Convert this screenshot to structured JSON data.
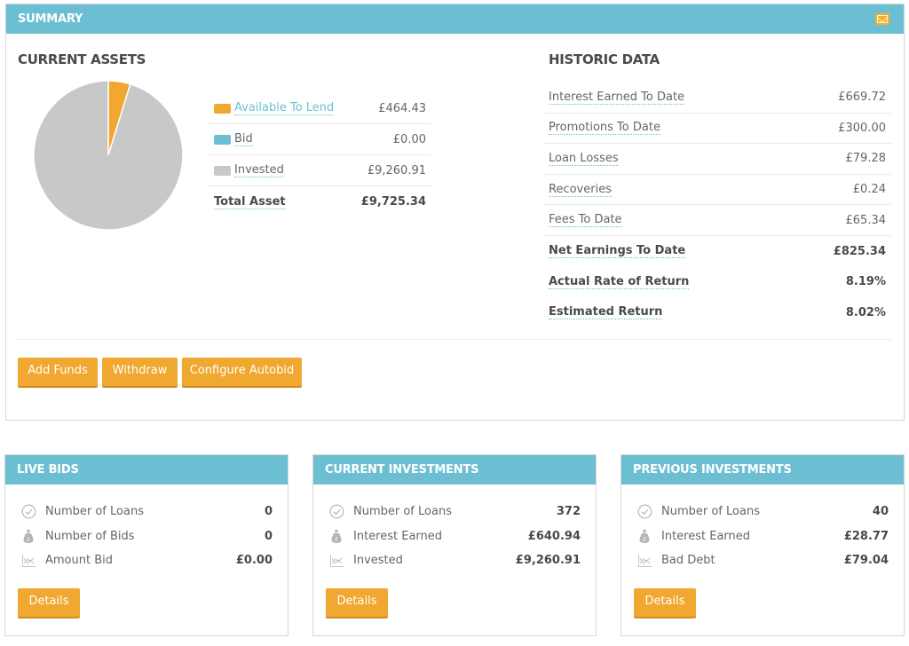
{
  "summary": {
    "title": "SUMMARY",
    "header_icon": "envelope-icon",
    "current_assets": {
      "title": "CURRENT ASSETS",
      "legend": [
        {
          "label": "Available To Lend",
          "value": "£464.43",
          "color": "#f0a830",
          "link": true
        },
        {
          "label": "Bid",
          "value": "£0.00",
          "color": "#6cbfd2",
          "link": false
        },
        {
          "label": "Invested",
          "value": "£9,260.91",
          "color": "#c8c8c8",
          "link": false
        }
      ],
      "total": {
        "label": "Total Asset",
        "value": "£9,725.34"
      }
    },
    "historic_data": {
      "title": "HISTORIC DATA",
      "rows": [
        {
          "label": "Interest Earned To Date",
          "value": "£669.72"
        },
        {
          "label": "Promotions To Date",
          "value": "£300.00"
        },
        {
          "label": "Loan Losses",
          "value": "£79.28"
        },
        {
          "label": "Recoveries",
          "value": "£0.24"
        },
        {
          "label": "Fees To Date",
          "value": "£65.34"
        }
      ],
      "bold_rows": [
        {
          "label": "Net Earnings To Date",
          "value": "£825.34"
        },
        {
          "label": "Actual Rate of Return",
          "value": "8.19%"
        },
        {
          "label": "Estimated Return",
          "value": "8.02%"
        }
      ]
    },
    "buttons": {
      "add_funds": "Add Funds",
      "withdraw": "Withdraw",
      "configure_autobid": "Configure Autobid"
    }
  },
  "chart_data": {
    "type": "pie",
    "title": "",
    "slices": [
      {
        "label": "Available To Lend",
        "value": 464.43,
        "color": "#f0a830"
      },
      {
        "label": "Bid",
        "value": 0.0,
        "color": "#6cbfd2"
      },
      {
        "label": "Invested",
        "value": 9260.91,
        "color": "#c8c8c8"
      }
    ]
  },
  "cards": [
    {
      "title": "LIVE BIDS",
      "rows": [
        {
          "icon": "check-circle-icon",
          "label": "Number of Loans",
          "value": "0"
        },
        {
          "icon": "money-bag-icon",
          "label": "Number of Bids",
          "value": "0"
        },
        {
          "icon": "chart-icon",
          "label": "Amount Bid",
          "value": "£0.00"
        }
      ],
      "button": "Details"
    },
    {
      "title": "CURRENT INVESTMENTS",
      "rows": [
        {
          "icon": "check-circle-icon",
          "label": "Number of Loans",
          "value": "372"
        },
        {
          "icon": "money-bag-icon",
          "label": "Interest Earned",
          "value": "£640.94"
        },
        {
          "icon": "chart-icon",
          "label": "Invested",
          "value": "£9,260.91"
        }
      ],
      "button": "Details"
    },
    {
      "title": "PREVIOUS INVESTMENTS",
      "rows": [
        {
          "icon": "check-circle-icon",
          "label": "Number of Loans",
          "value": "40"
        },
        {
          "icon": "money-bag-icon",
          "label": "Interest Earned",
          "value": "£28.77"
        },
        {
          "icon": "chart-icon",
          "label": "Bad Debt",
          "value": "£79.04"
        }
      ],
      "button": "Details"
    }
  ]
}
